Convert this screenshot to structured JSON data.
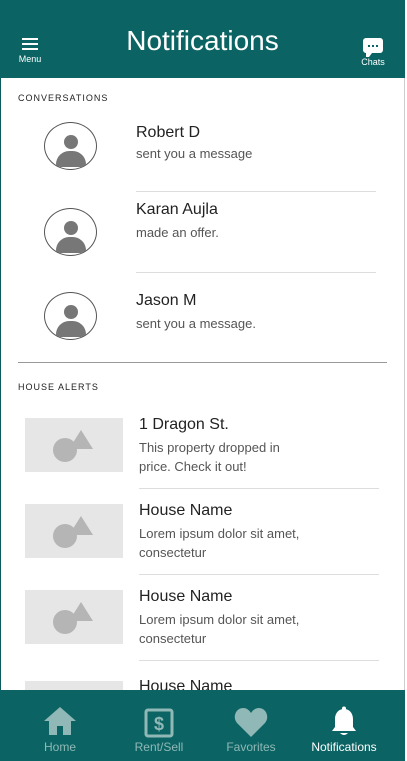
{
  "header": {
    "title": "Notifications",
    "menu_label": "Menu",
    "chats_label": "Chats"
  },
  "conversations": {
    "section_title": "CONVERSATIONS",
    "items": [
      {
        "name": "Robert D",
        "message": "sent you a message"
      },
      {
        "name": "Karan Aujla",
        "message": "made an offer."
      },
      {
        "name": "Jason M",
        "message": "sent you a message."
      }
    ]
  },
  "house_alerts": {
    "section_title": "HOUSE ALERTS",
    "items": [
      {
        "name": "1 Dragon St.",
        "description": "This property dropped in price. Check it out!"
      },
      {
        "name": "House Name",
        "description": "Lorem ipsum dolor sit amet, consectetur"
      },
      {
        "name": "House Name",
        "description": "Lorem ipsum dolor sit amet, consectetur"
      },
      {
        "name": "House Name",
        "description": ""
      }
    ]
  },
  "bottom_nav": {
    "items": [
      {
        "label": "Home",
        "icon": "home-icon",
        "active": false
      },
      {
        "label": "Rent/Sell",
        "icon": "dollar-card-icon",
        "active": false
      },
      {
        "label": "Favorites",
        "icon": "heart-icon",
        "active": false
      },
      {
        "label": "Notifications",
        "icon": "bell-icon",
        "active": true
      }
    ]
  },
  "colors": {
    "primary": "#0b6463",
    "inactive_nav": "#8fb8b7",
    "placeholder": "#e6e6e6"
  }
}
